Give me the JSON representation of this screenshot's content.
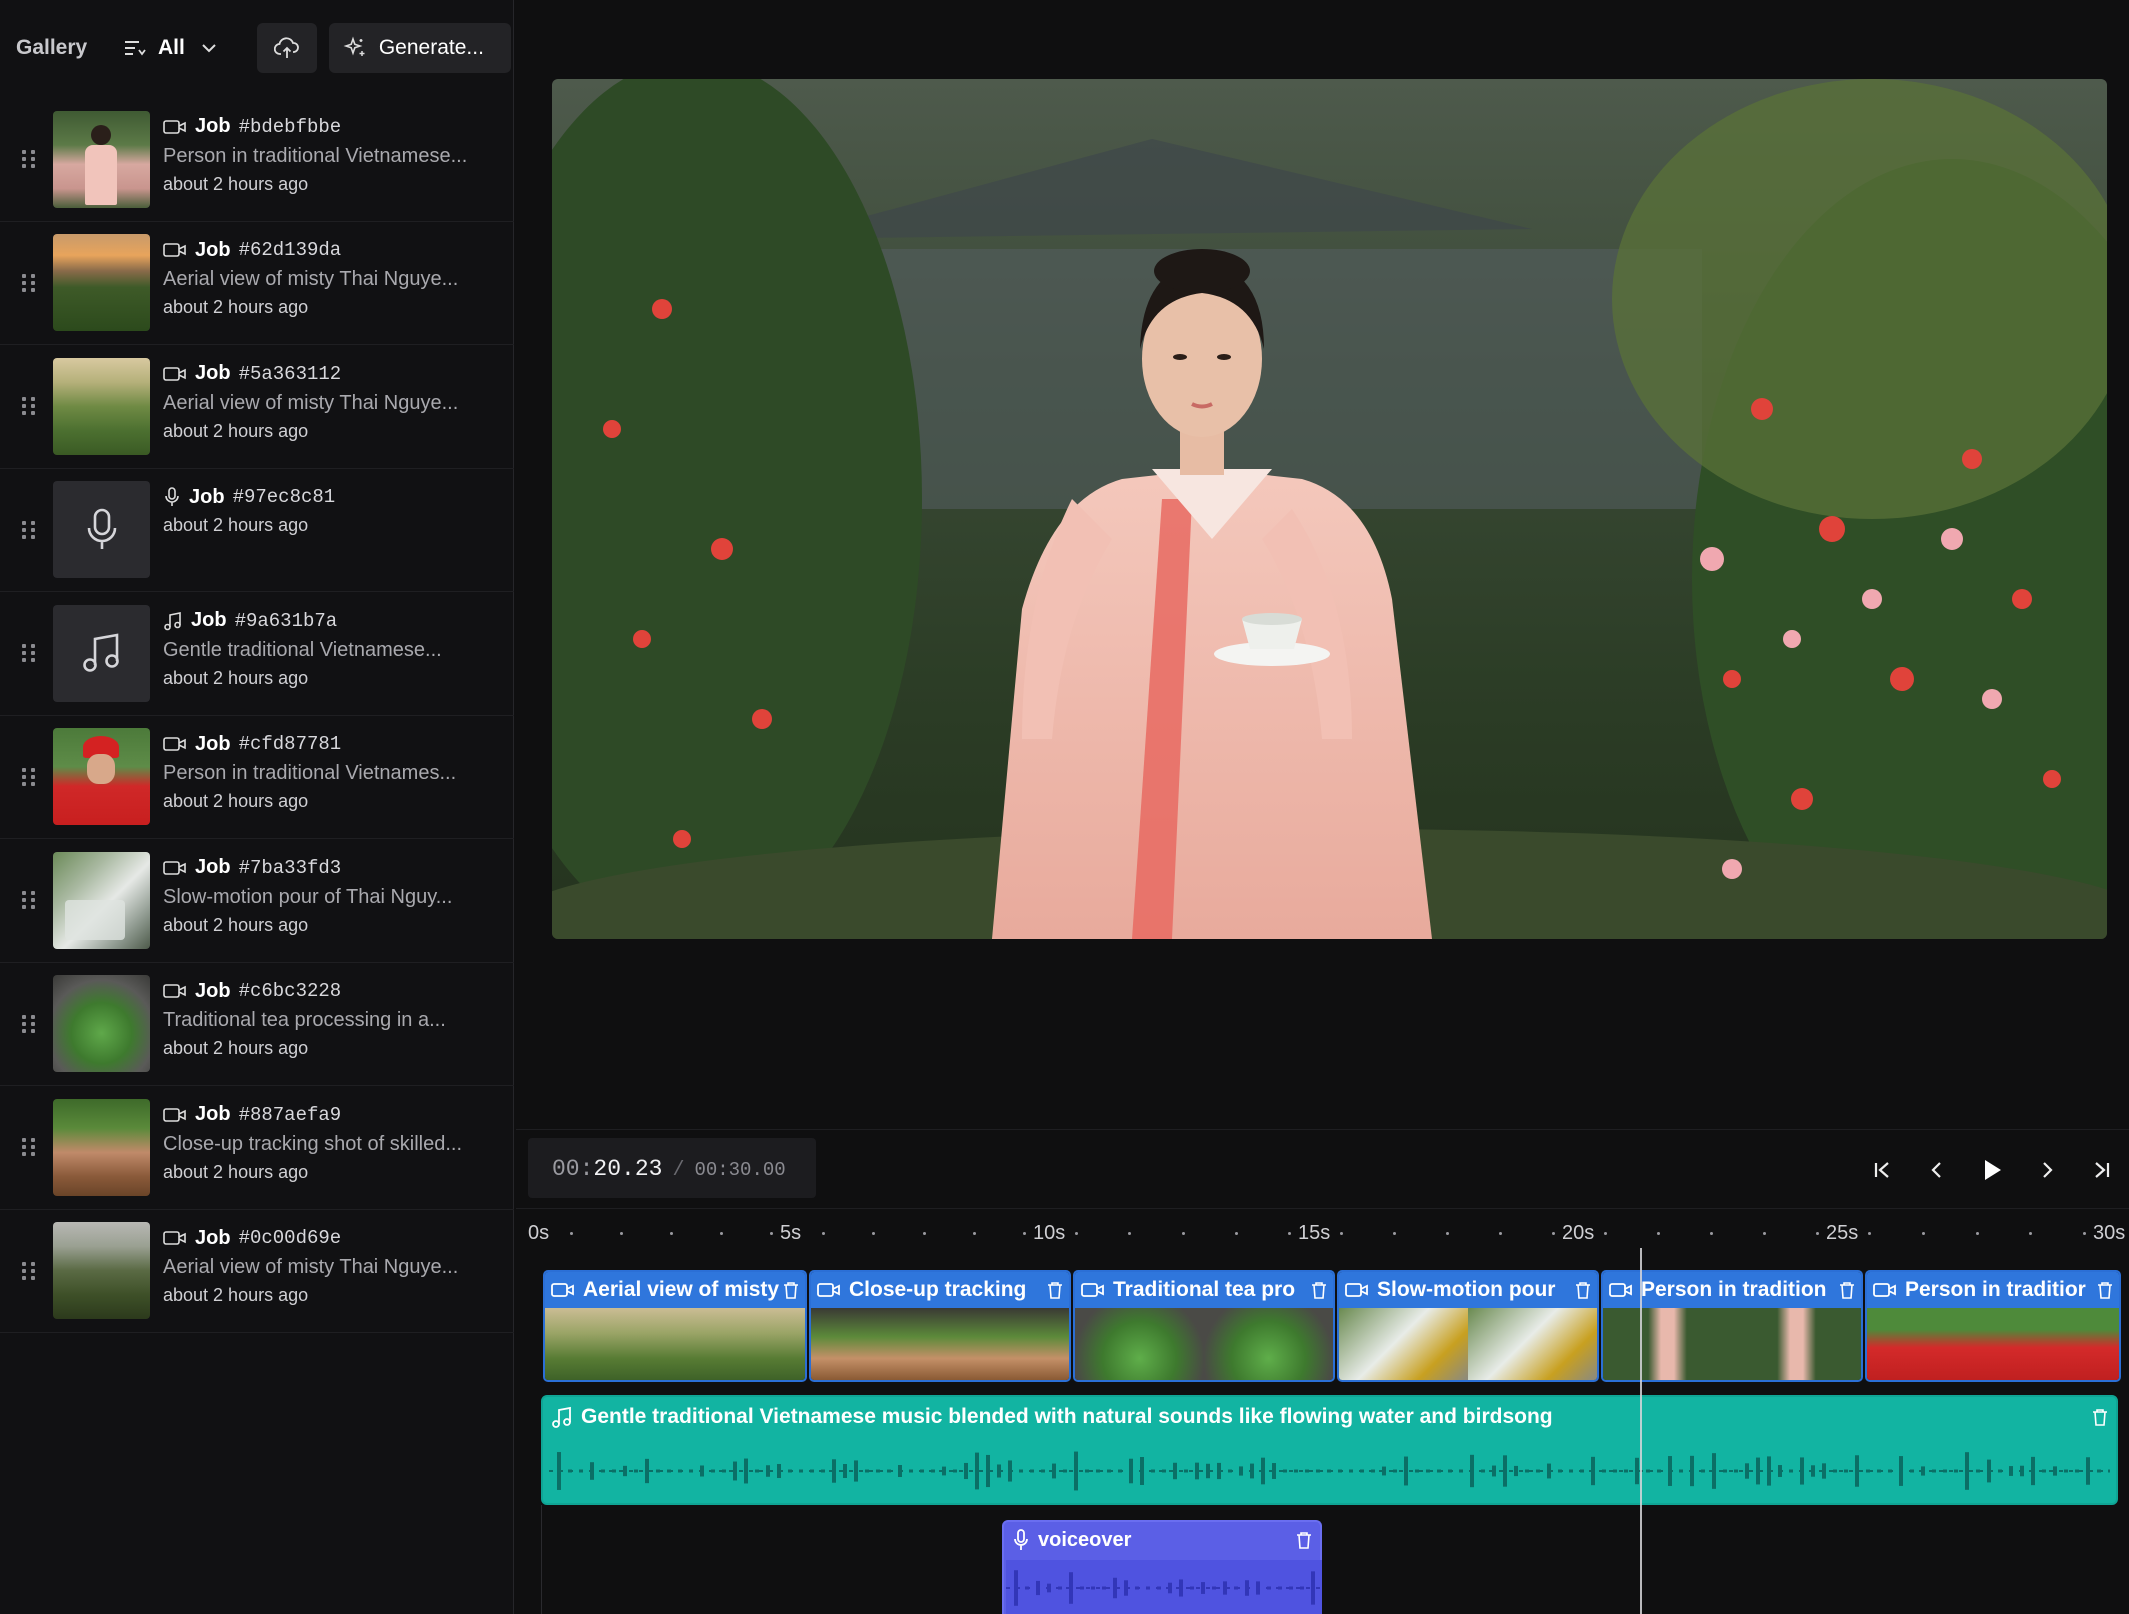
{
  "sidebar": {
    "title": "Gallery",
    "filter_label": "All",
    "generate_label": "Generate..."
  },
  "jobs": [
    {
      "type": "video",
      "label": "Job",
      "id": "#bdebfbbe",
      "desc": "Person in traditional Vietnamese...",
      "time": "about 2 hours ago"
    },
    {
      "type": "video",
      "label": "Job",
      "id": "#62d139da",
      "desc": "Aerial view of misty Thai Nguye...",
      "time": "about 2 hours ago"
    },
    {
      "type": "video",
      "label": "Job",
      "id": "#5a363112",
      "desc": "Aerial view of misty Thai Nguye...",
      "time": "about 2 hours ago"
    },
    {
      "type": "voice",
      "label": "Job",
      "id": "#97ec8c81",
      "desc": "",
      "time": "about 2 hours ago"
    },
    {
      "type": "music",
      "label": "Job",
      "id": "#9a631b7a",
      "desc": "Gentle traditional Vietnamese...",
      "time": "about 2 hours ago"
    },
    {
      "type": "video",
      "label": "Job",
      "id": "#cfd87781",
      "desc": "Person in traditional Vietnames...",
      "time": "about 2 hours ago"
    },
    {
      "type": "video",
      "label": "Job",
      "id": "#7ba33fd3",
      "desc": "Slow-motion pour of Thai Nguy...",
      "time": "about 2 hours ago"
    },
    {
      "type": "video",
      "label": "Job",
      "id": "#c6bc3228",
      "desc": "Traditional tea processing in a...",
      "time": "about 2 hours ago"
    },
    {
      "type": "video",
      "label": "Job",
      "id": "#887aefa9",
      "desc": "Close-up tracking shot of skilled...",
      "time": "about 2 hours ago"
    },
    {
      "type": "video",
      "label": "Job",
      "id": "#0c00d69e",
      "desc": "Aerial view of misty Thai Nguye...",
      "time": "about 2 hours ago"
    }
  ],
  "transport": {
    "current_min": "00:",
    "current_sec": "20.23",
    "separator": "/",
    "total": "00:30.00"
  },
  "ruler": {
    "labels": [
      "0s",
      "5s",
      "10s",
      "15s",
      "20s",
      "25s",
      "30s"
    ]
  },
  "timeline": {
    "clips": [
      {
        "name": "Aerial view of misty"
      },
      {
        "name": "Close-up tracking"
      },
      {
        "name": "Traditional tea pro"
      },
      {
        "name": "Slow-motion pour"
      },
      {
        "name": "Person in tradition"
      },
      {
        "name": "Person in traditior"
      }
    ],
    "music_label": "Gentle traditional Vietnamese music blended with natural sounds like flowing water and birdsong",
    "voiceover_label": "voiceover"
  },
  "colors": {
    "video_clip": "#2f76dc",
    "music_track": "#12b4a2",
    "voiceover_track": "#5b5fe6"
  }
}
